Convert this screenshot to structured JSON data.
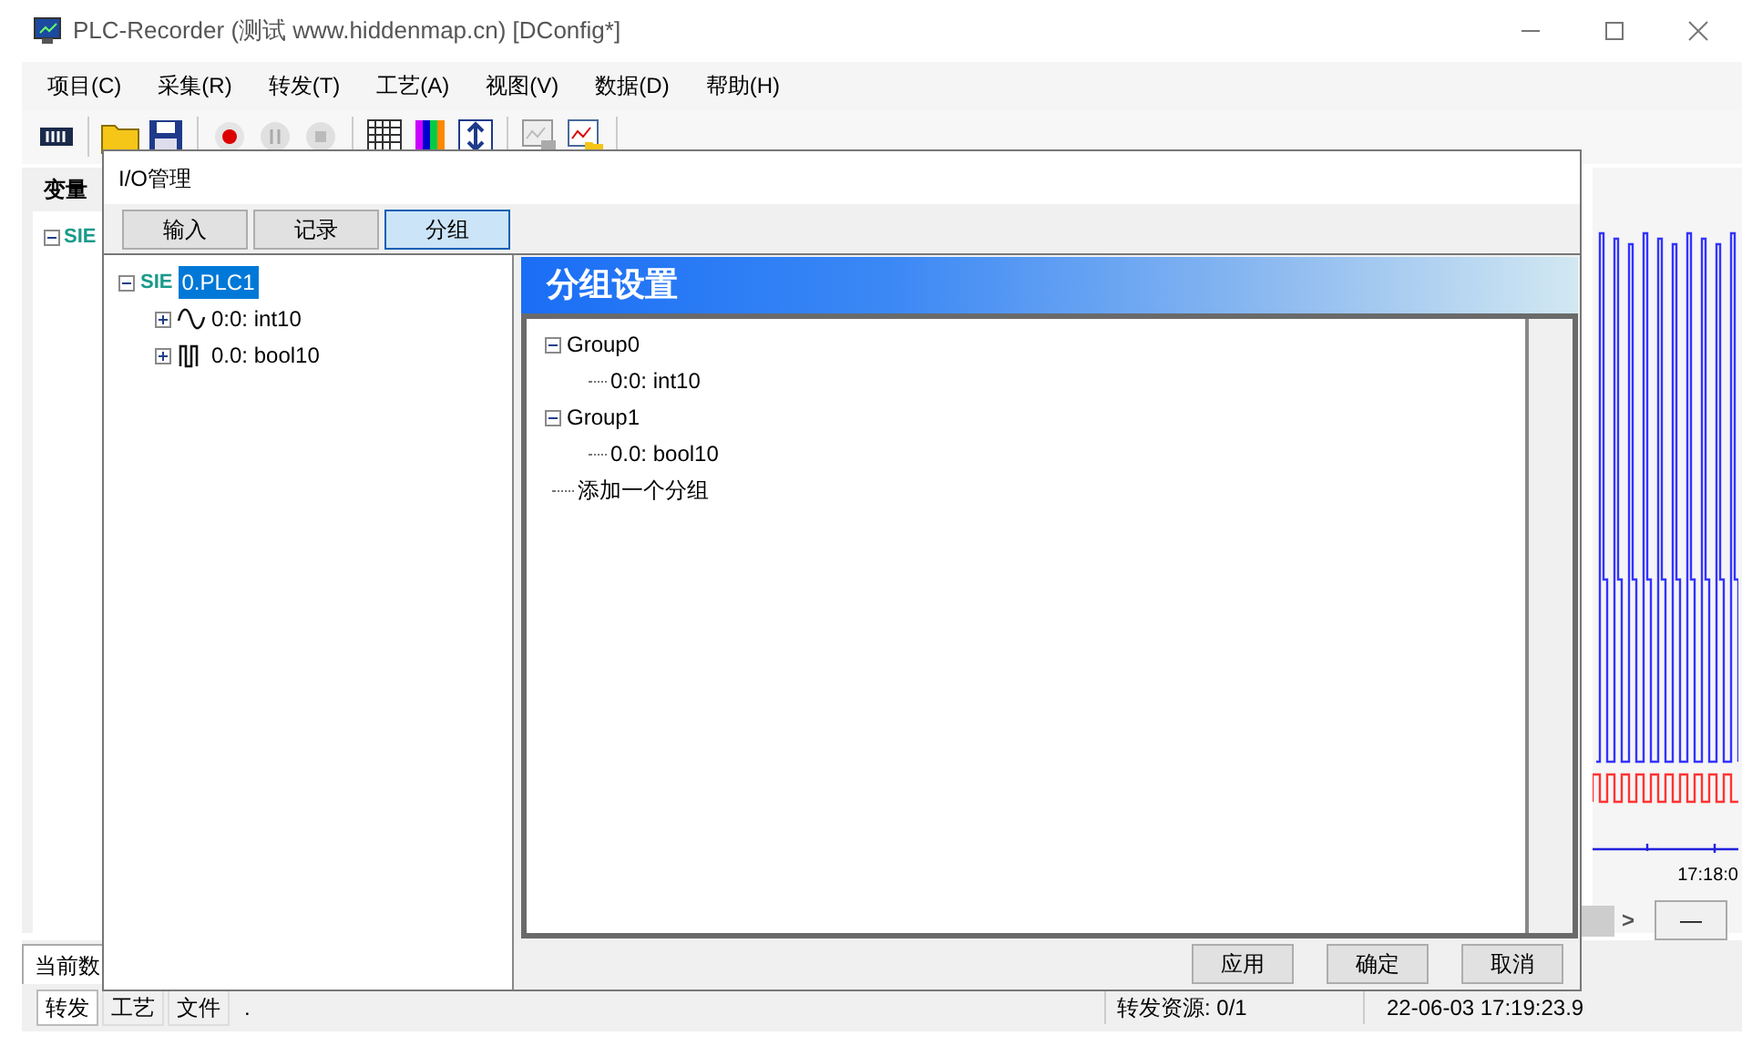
{
  "window": {
    "title": "PLC-Recorder (测试 www.hiddenmap.cn) [DConfig*]"
  },
  "menu": [
    "项目(C)",
    "采集(R)",
    "转发(T)",
    "工艺(A)",
    "视图(V)",
    "数据(D)",
    "帮助(H)"
  ],
  "left_panel": {
    "tab": "变量",
    "tree_root": "SIE"
  },
  "chart": {
    "time_label": "17:18:0",
    "scroll_right": ">",
    "zoom_button": "—"
  },
  "bottom_tab": "当前数",
  "status_bar": {
    "tabs": [
      {
        "label": "转发",
        "selected": true
      },
      {
        "label": "工艺",
        "selected": false
      },
      {
        "label": "文件",
        "selected": false
      }
    ],
    "text": ".",
    "forward_resources": "转发资源:  0/1",
    "timestamp": "22-06-03 17:19:23.9"
  },
  "dialog": {
    "title": "I/O管理",
    "tabs": [
      {
        "label": "输入",
        "selected": false
      },
      {
        "label": "记录",
        "selected": false
      },
      {
        "label": "分组",
        "selected": true
      }
    ],
    "io_tree": {
      "root_prefix": "SIE",
      "root": "0.PLC1",
      "root_selected": true,
      "expanded": true,
      "children": [
        {
          "kind": "analog",
          "label": "0:0: int10",
          "expanded": false
        },
        {
          "kind": "digital",
          "label": "0.0: bool10",
          "expanded": false
        }
      ]
    },
    "group_panel": {
      "title": "分组设置",
      "groups": [
        {
          "label": "Group0",
          "expanded": true,
          "children": [
            "0:0: int10"
          ]
        },
        {
          "label": "Group1",
          "expanded": true,
          "children": [
            "0.0: bool10"
          ]
        }
      ],
      "add_item": "添加一个分组"
    },
    "buttons": [
      "应用",
      "确定",
      "取消"
    ]
  }
}
